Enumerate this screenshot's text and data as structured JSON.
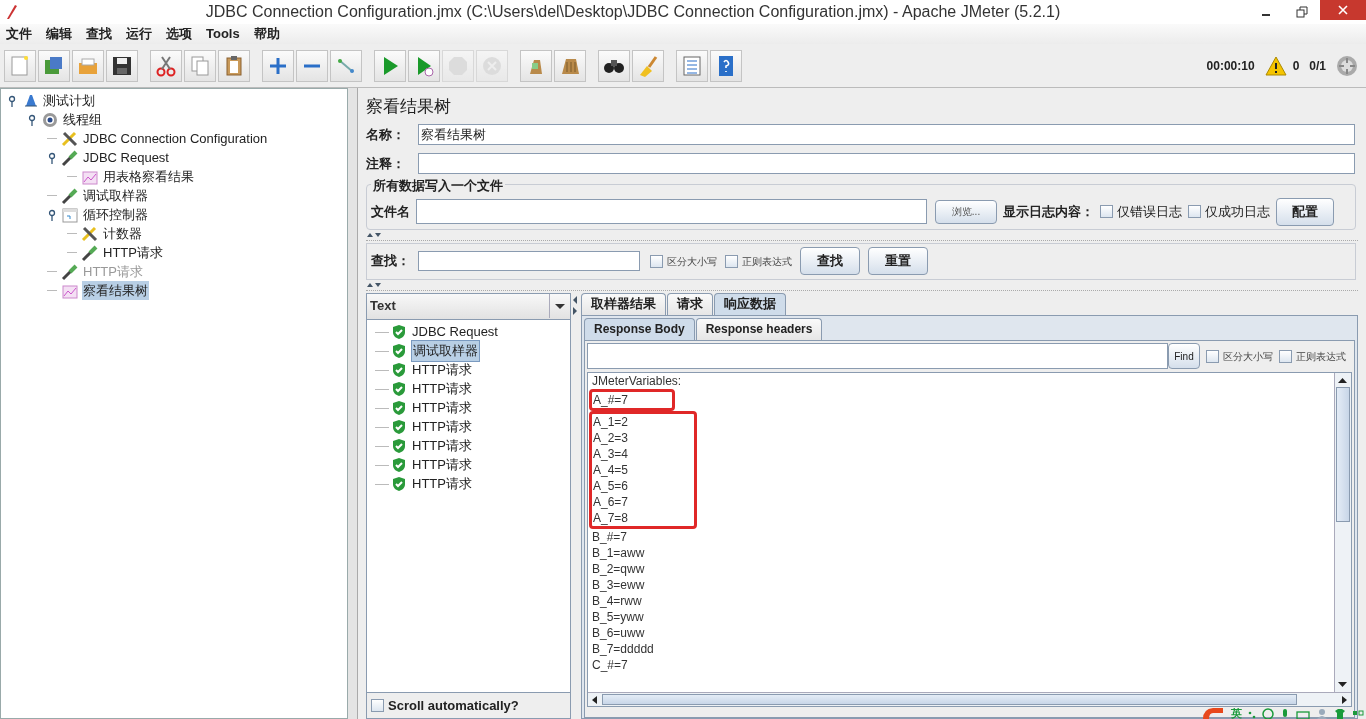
{
  "window": {
    "title": "JDBC Connection Configuration.jmx (C:\\Users\\del\\Desktop\\JDBC Connection Configuration.jmx) - Apache JMeter (5.2.1)"
  },
  "menu": [
    "文件",
    "编辑",
    "查找",
    "运行",
    "选项",
    "Tools",
    "帮助"
  ],
  "toolbar": [
    {
      "kind": "new",
      "disabled": false
    },
    {
      "kind": "templates",
      "disabled": false
    },
    {
      "kind": "open",
      "disabled": false
    },
    {
      "kind": "save",
      "disabled": false
    },
    {
      "kind": "sep"
    },
    {
      "kind": "cut",
      "disabled": false
    },
    {
      "kind": "copy",
      "disabled": false
    },
    {
      "kind": "paste",
      "disabled": false
    },
    {
      "kind": "sep"
    },
    {
      "kind": "expand",
      "disabled": false
    },
    {
      "kind": "collapse",
      "disabled": false
    },
    {
      "kind": "toggle",
      "disabled": false
    },
    {
      "kind": "sep"
    },
    {
      "kind": "start",
      "disabled": false
    },
    {
      "kind": "start-no-pause",
      "disabled": false
    },
    {
      "kind": "stop",
      "disabled": true
    },
    {
      "kind": "shutdown",
      "disabled": true
    },
    {
      "kind": "sep"
    },
    {
      "kind": "clear",
      "disabled": false
    },
    {
      "kind": "clear-all",
      "disabled": false
    },
    {
      "kind": "sep"
    },
    {
      "kind": "search",
      "disabled": false
    },
    {
      "kind": "reset-search",
      "disabled": false
    },
    {
      "kind": "sep"
    },
    {
      "kind": "functions",
      "disabled": false
    },
    {
      "kind": "help",
      "disabled": false
    }
  ],
  "status": {
    "elapsed": "00:00:10",
    "warnings": "0",
    "threads": "0/1"
  },
  "tree": [
    {
      "label": "测试计划",
      "kind": "plan",
      "disabled": false,
      "selected": false,
      "expanded": true,
      "children": [
        {
          "label": "线程组",
          "kind": "threads",
          "disabled": false,
          "selected": false,
          "expanded": true,
          "children": [
            {
              "label": "JDBC Connection Configuration",
              "kind": "config",
              "disabled": false,
              "selected": false
            },
            {
              "label": "JDBC Request",
              "kind": "sampler",
              "disabled": false,
              "selected": false,
              "expanded": true,
              "children": [
                {
                  "label": "用表格察看结果",
                  "kind": "listener",
                  "disabled": false,
                  "selected": false
                }
              ]
            },
            {
              "label": "调试取样器",
              "kind": "sampler",
              "disabled": false,
              "selected": false
            },
            {
              "label": "循环控制器",
              "kind": "controller",
              "disabled": false,
              "selected": false,
              "expanded": true,
              "children": [
                {
                  "label": "计数器",
                  "kind": "config",
                  "disabled": false,
                  "selected": false
                },
                {
                  "label": "HTTP请求",
                  "kind": "sampler",
                  "disabled": false,
                  "selected": false
                }
              ]
            },
            {
              "label": "HTTP请求",
              "kind": "sampler",
              "disabled": true,
              "selected": false
            },
            {
              "label": "察看结果树",
              "kind": "listener",
              "disabled": false,
              "selected": true
            }
          ]
        }
      ]
    }
  ],
  "panel": {
    "heading": "察看结果树",
    "name_label": "名称：",
    "name_value": "察看结果树",
    "comment_label": "注释：",
    "file_group": {
      "legend": "所有数据写入一个文件",
      "file_label": "文件名",
      "browse": "浏览...",
      "log_label": "显示日志内容：",
      "errors_only": {
        "label": "仅错误日志",
        "checked": false
      },
      "success_only": {
        "label": "仅成功日志",
        "checked": false
      },
      "configure": "配置"
    },
    "search": {
      "label": "查找：",
      "case": {
        "label": "区分大小写",
        "checked": false
      },
      "regex": {
        "label": "正则表达式",
        "checked": false
      },
      "find": "查找",
      "reset": "重置"
    }
  },
  "results": {
    "renderer": "Text",
    "items": [
      {
        "label": "JDBC Request",
        "selected": false
      },
      {
        "label": "调试取样器",
        "selected": true
      },
      {
        "label": "HTTP请求",
        "selected": false
      },
      {
        "label": "HTTP请求",
        "selected": false
      },
      {
        "label": "HTTP请求",
        "selected": false
      },
      {
        "label": "HTTP请求",
        "selected": false
      },
      {
        "label": "HTTP请求",
        "selected": false
      },
      {
        "label": "HTTP请求",
        "selected": false
      },
      {
        "label": "HTTP请求",
        "selected": false
      }
    ],
    "scroll_auto": {
      "label": "Scroll automatically?",
      "checked": false
    }
  },
  "tabs": [
    {
      "label": "取样器结果",
      "selected": false
    },
    {
      "label": "请求",
      "selected": false
    },
    {
      "label": "响应数据",
      "selected": true
    }
  ],
  "subtabs": [
    {
      "label": "Response Body",
      "selected": true
    },
    {
      "label": "Response headers",
      "selected": false
    }
  ],
  "body_search": {
    "find": "Find",
    "case": {
      "label": "区分大小写",
      "checked": false
    },
    "regex": {
      "label": "正则表达式",
      "checked": false
    }
  },
  "body": [
    {
      "kind": "plain",
      "lines": [
        "JMeterVariables:"
      ]
    },
    {
      "kind": "boxed",
      "lines": [
        "A_#=7"
      ]
    },
    {
      "kind": "boxed",
      "lines": [
        "A_1=2",
        "A_2=3",
        "A_3=4",
        "A_4=5",
        "A_5=6",
        "A_6=7",
        "A_7=8"
      ]
    },
    {
      "kind": "plain",
      "lines": [
        "B_#=7",
        "B_1=aww",
        "B_2=qww",
        "B_3=eww",
        "B_4=rww",
        "B_5=yww",
        "B_6=uww",
        "B_7=ddddd",
        "C_#=7"
      ]
    }
  ],
  "ime": {
    "mode": "英"
  }
}
